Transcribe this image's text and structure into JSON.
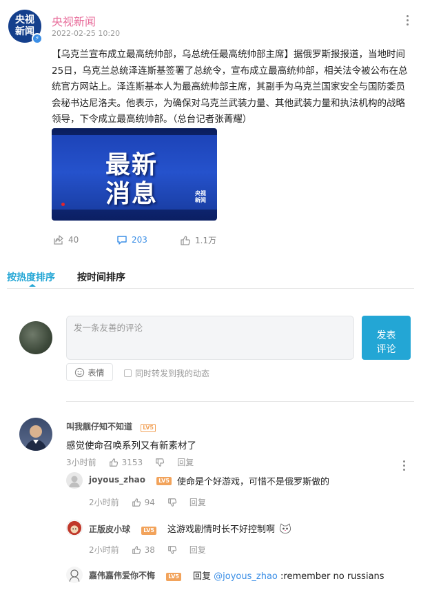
{
  "post": {
    "avatar_text_1": "央视",
    "avatar_text_2": "新闻",
    "author": "央视新闻",
    "time": "2022-02-25 10:20",
    "text": "【乌克兰宣布成立最高统帅部，乌总统任最高统帅部主席】据俄罗斯报报道，当地时间25日，乌克兰总统泽连斯基签署了总统令，宣布成立最高统帅部，相关法令被公布在总统官方网站上。泽连斯基本人为最高统帅部主席，其副手为乌克兰国家安全与国防委员会秘书达尼洛夫。他表示，为确保对乌克兰武装力量、其他武装力量和执法机构的战略领导，下令成立最高统帅部。（总台记者张菁耀）",
    "image": {
      "line1": "最新",
      "line2": "消息",
      "logo_1": "央视",
      "logo_2": "新闻"
    },
    "stats": {
      "reposts": "40",
      "comments": "203",
      "likes": "1.1万"
    }
  },
  "tabs": {
    "hot": "按热度排序",
    "time": "按时间排序"
  },
  "composer": {
    "placeholder": "发一条友善的评论",
    "submit_line1": "发表",
    "submit_line2": "评论",
    "emoji_label": "表情",
    "repost_label": "同时转发到我的动态"
  },
  "comments": [
    {
      "user": "叫我靓仔知不知道",
      "level": "LV5",
      "text": "感觉使命召唤系列又有新素材了",
      "time": "3小时前",
      "likes": "3153",
      "reply_label": "回复"
    }
  ],
  "replies": [
    {
      "user": "joyous_zhao",
      "level": "LV5",
      "text": "使命是个好游戏，可惜不是俄罗斯做的",
      "time": "2小时前",
      "likes": "94",
      "reply_label": "回复"
    },
    {
      "user": "正版皮小球",
      "level": "LV5",
      "text": "这游戏剧情时长不好控制啊",
      "time": "2小时前",
      "likes": "38",
      "reply_label": "回复"
    },
    {
      "user": "嘉伟嘉伟爱你不悔",
      "level": "LV5",
      "prefix": "回复",
      "mention": "@joyous_zhao",
      "text": ":remember no russians"
    }
  ],
  "colors": {
    "accent": "#23a6d5",
    "author_pink": "#e86f9c",
    "link_blue": "#3a8ee6",
    "level_orange": "#f2a35b"
  }
}
